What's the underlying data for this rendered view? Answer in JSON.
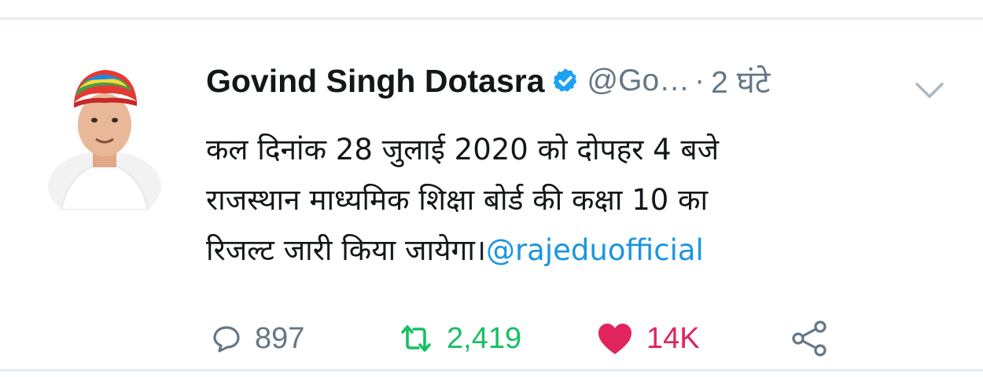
{
  "tweet": {
    "author_name": "Govind Singh Dotasra",
    "handle": "@Go…",
    "separator": "·",
    "time": "2 घंटे",
    "text_lines": [
      "कल दिनांक 28 जुलाई 2020 को दोपहर 4 बजे",
      "राजस्थान माध्यमिक शिक्षा बोर्ड की कक्षा 10 का",
      "रिजल्ट जारी किया जायेगा।"
    ],
    "mention": "@rajeduofficial"
  },
  "actions": {
    "reply_count": "897",
    "retweet_count": "2,419",
    "like_count": "14K"
  },
  "icons": {
    "verified": "verified-badge-icon",
    "caret": "chevron-down-icon",
    "reply": "reply-icon",
    "retweet": "retweet-icon",
    "like": "heart-icon",
    "share": "share-icon"
  },
  "colors": {
    "text": "#14171a",
    "muted": "#657786",
    "link": "#1b95e0",
    "retweet": "#17bf63",
    "like": "#e0245e"
  }
}
